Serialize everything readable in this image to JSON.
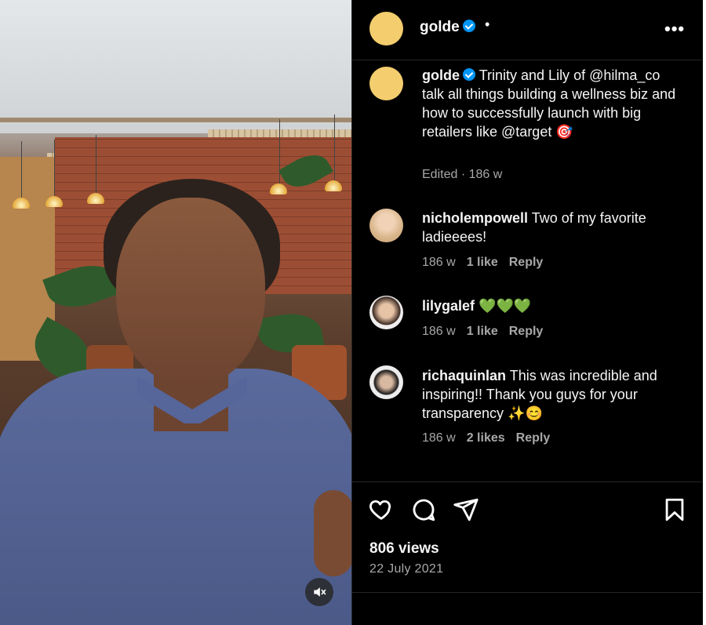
{
  "post": {
    "author": "golde",
    "caption": {
      "author": "golde",
      "text": "Trinity and Lily of @hilma_co talk all things building a wellness biz and how to successfully launch with big retailers like @target 🎯",
      "meta": "Edited · 186 w"
    }
  },
  "header": {
    "username": "golde",
    "dot": "•",
    "more": "•••"
  },
  "comments": [
    {
      "username": "nicholempowell",
      "text": "Two of my favorite ladieeees!",
      "age": "186 w",
      "likes": "1 like",
      "reply": "Reply"
    },
    {
      "username": "lilygalef",
      "text": "💚💚💚",
      "age": "186 w",
      "likes": "1 like",
      "reply": "Reply"
    },
    {
      "username": "richaquinlan",
      "text": "This was incredible and inspiring!! Thank you guys for your transparency ✨😊",
      "age": "186 w",
      "likes": "2 likes",
      "reply": "Reply"
    }
  ],
  "stats": {
    "views": "806 views",
    "date": "22 July 2021"
  },
  "icons": {
    "verified": "verified-badge-icon",
    "like": "heart-icon",
    "comment": "comment-bubble-icon",
    "share": "paper-plane-icon",
    "save": "bookmark-icon",
    "mute": "speaker-muted-icon"
  },
  "colors": {
    "accent": "#0095f6",
    "avatar_brand": "#f3cd6e",
    "background": "#000000"
  }
}
